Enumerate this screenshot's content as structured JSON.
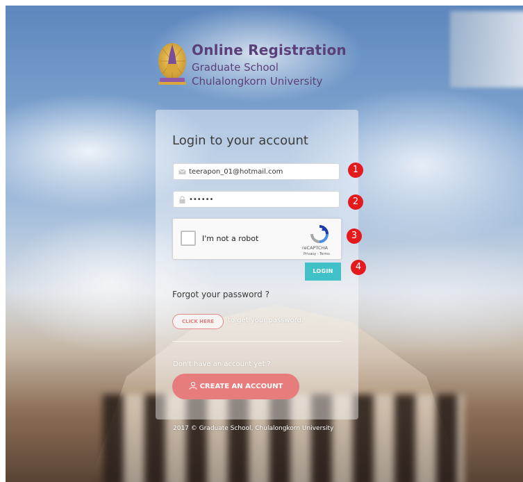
{
  "header": {
    "title": "Online Registration",
    "subtitle": "Graduate School",
    "subtitle2": "Chulalongkorn University",
    "logo_icon": "chula-crest-icon"
  },
  "login": {
    "heading": "Login to your account",
    "email_value": "teerapon_01@hotmail.com",
    "email_icon": "envelope-icon",
    "password_value": "••••••",
    "password_icon": "lock-icon",
    "captcha": {
      "label": "I'm not a robot",
      "brand": "reCAPTCHA",
      "links": "Privacy - Terms"
    },
    "login_label": "LOGIN"
  },
  "badges": [
    "1",
    "2",
    "3",
    "4"
  ],
  "forgot": {
    "heading": "Forgot your password ?",
    "button_label": "CLICK HERE",
    "suffix": "to get your password."
  },
  "signup": {
    "prompt": "Don't have an account yet ?",
    "button_label": "CREATE AN ACCOUNT",
    "icon": "user-icon"
  },
  "footer": {
    "text": "2017 © Graduate School, Chulalongkorn University"
  },
  "colors": {
    "brand_purple": "#5b3f78",
    "login_teal": "#3fc1c7",
    "create_pink": "#e67c7c",
    "badge_red": "#e41a1c"
  }
}
